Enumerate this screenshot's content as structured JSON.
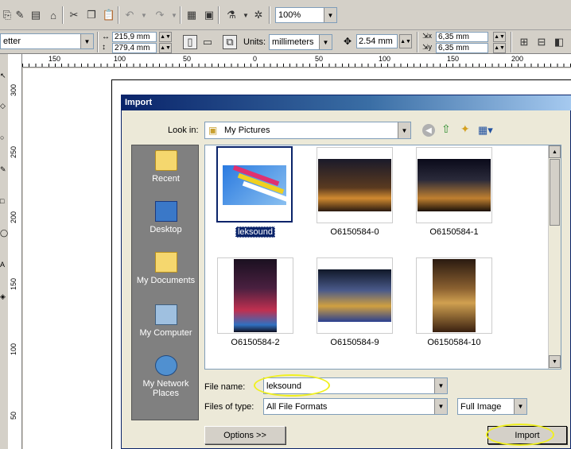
{
  "toolbar": {
    "zoom": "100%",
    "paper_size": "etter",
    "width": "215,9 mm",
    "height": "279,4 mm",
    "units_label": "Units:",
    "units_value": "millimeters",
    "nudge": "2.54 mm",
    "dup_x": "6,35 mm",
    "dup_y": "6,35 mm"
  },
  "ruler": {
    "h_ticks": [
      "150",
      "100",
      "50",
      "0",
      "50",
      "100",
      "150",
      "200"
    ],
    "v_ticks": [
      "300",
      "250",
      "200",
      "150",
      "100",
      "50"
    ]
  },
  "dialog": {
    "title": "Import",
    "look_in_label": "Look in:",
    "look_in_value": "My Pictures",
    "places": [
      {
        "label": "Recent"
      },
      {
        "label": "Desktop"
      },
      {
        "label": "My Documents"
      },
      {
        "label": "My Computer"
      },
      {
        "label": "My Network Places"
      }
    ],
    "files": [
      {
        "name": "leksound",
        "selected": true
      },
      {
        "name": "O6150584-0"
      },
      {
        "name": "O6150584-1"
      },
      {
        "name": "O6150584-2"
      },
      {
        "name": "O6150584-9"
      },
      {
        "name": "O6150584-10"
      }
    ],
    "file_name_label": "File name:",
    "file_name_value": "leksound",
    "files_of_type_label": "Files of type:",
    "files_of_type_value": "All File Formats",
    "image_mode": "Full Image",
    "options_button": "Options >>",
    "import_button": "Import"
  },
  "colors": {
    "highlight_ellipse": "#f0f020",
    "selection": "#0a246a"
  }
}
